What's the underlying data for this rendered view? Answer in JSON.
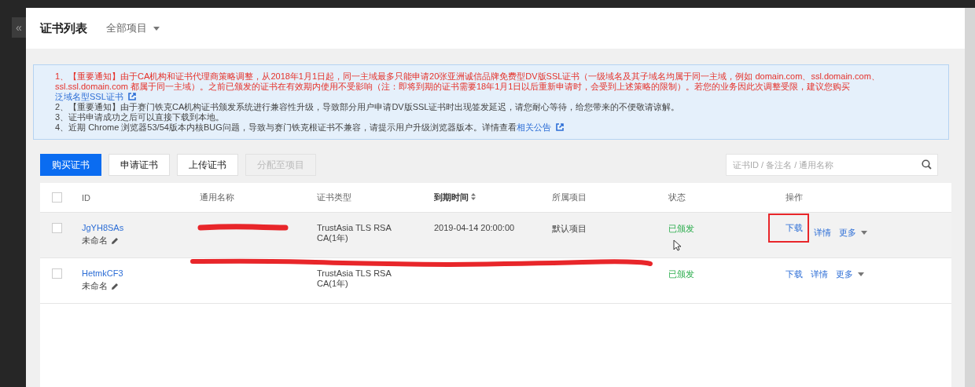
{
  "sidebar": {
    "collapse_toggle": "«"
  },
  "header": {
    "title": "证书列表",
    "project_filter": "全部项目"
  },
  "notices": [
    {
      "kind": "important",
      "text": "1、【重要通知】由于CA机构和证书代理商策略调整，从2018年1月1日起，同一主域最多只能申请20张亚洲诚信品牌免费型DV版SSL证书（一级域名及其子域名均属于同一主域，例如 domain.com、ssl.domain.com、ssl.ssl.domain.com 都属于同一主域）。之前已颁发的证书在有效期内使用不受影响（注：即将到期的证书需要18年1月1日以后重新申请时，会受到上述策略的限制）。若您的业务因此次调整受限，建议您购买",
      "link": "泛域名型SSL证书"
    },
    {
      "kind": "normal",
      "text": "2、【重要通知】由于赛门铁克CA机构证书颁发系统进行兼容性升级，导致部分用户申请DV版SSL证书时出现签发延迟，请您耐心等待，给您带来的不便敬请谅解。"
    },
    {
      "kind": "normal",
      "text": "3、证书申请成功之后可以直接下载到本地。"
    },
    {
      "kind": "normal",
      "text": "4、近期 Chrome 浏览器53/54版本内核BUG问题，导致与赛门铁克根证书不兼容，请提示用户升级浏览器版本。详情查看",
      "link": "相关公告"
    }
  ],
  "toolbar": {
    "buttons": [
      {
        "label": "购买证书",
        "kind": "primary",
        "disabled": false
      },
      {
        "label": "申请证书",
        "kind": "default",
        "disabled": false
      },
      {
        "label": "上传证书",
        "kind": "default",
        "disabled": false
      },
      {
        "label": "分配至项目",
        "kind": "default",
        "disabled": true
      }
    ],
    "search": {
      "placeholder": "证书ID / 备注名 / 通用名称"
    }
  },
  "table": {
    "select_all": false,
    "cursor": true,
    "columns": [
      {
        "label": "ID",
        "sortable": false
      },
      {
        "label": "通用名称",
        "sortable": false
      },
      {
        "label": "证书类型",
        "sortable": false
      },
      {
        "label": "到期时间",
        "sortable": true
      },
      {
        "label": "所属项目",
        "sortable": false
      },
      {
        "label": "状态",
        "sortable": false
      },
      {
        "label": "操作",
        "sortable": false
      }
    ],
    "rows": [
      {
        "checked": false,
        "hovered": true,
        "redacted": true,
        "id": "JgYH8SAs",
        "remark": "未命名",
        "type": "TrustAsia TLS RSA CA(1年)",
        "expires": "2019-04-14 20:00:00",
        "project": "默认项目",
        "status": "已颁发",
        "actions": [
          "下载",
          "详情",
          "更多"
        ],
        "annotated": true
      },
      {
        "checked": false,
        "hovered": false,
        "redacted": true,
        "id": "HetmkCF3",
        "remark": "未命名",
        "type": "TrustAsia TLS RSA CA(1年)",
        "status": "已颁发",
        "actions": [
          "下载",
          "详情",
          "更多"
        ],
        "annotated": false
      }
    ]
  }
}
